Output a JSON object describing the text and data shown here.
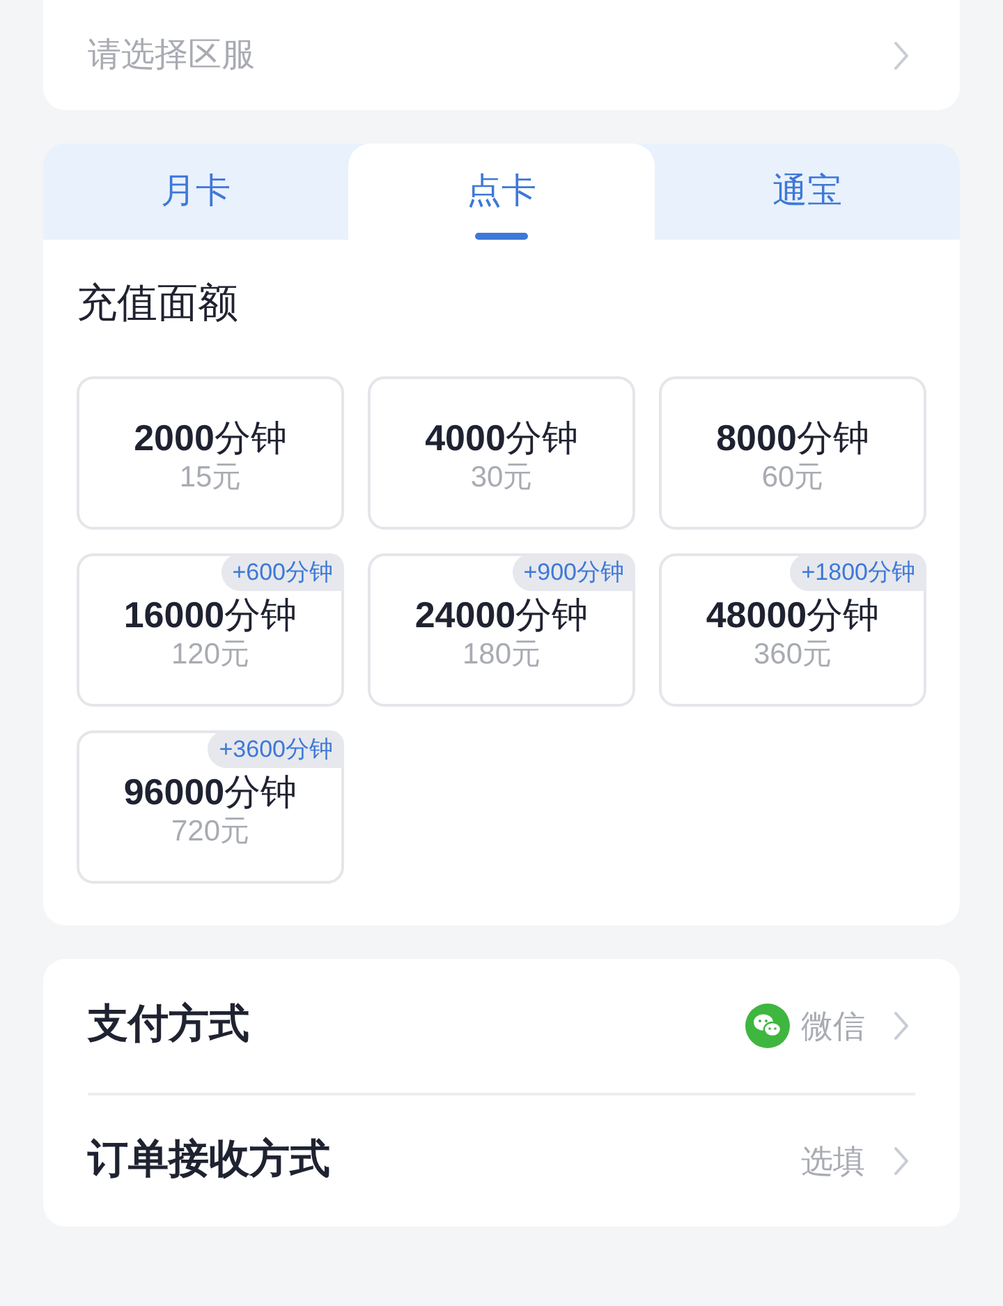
{
  "server_select": {
    "placeholder": "请选择区服"
  },
  "tabs": [
    {
      "label": "月卡",
      "selected": false
    },
    {
      "label": "点卡",
      "selected": true
    },
    {
      "label": "通宝",
      "selected": false
    }
  ],
  "section_title": "充值面额",
  "options": [
    {
      "amount": "**2000**分钟",
      "price": "15元"
    },
    {
      "amount": "**4000**分钟",
      "price": "30元"
    },
    {
      "amount": "**8000**分钟",
      "price": "60元"
    },
    {
      "amount": "**16000**分钟",
      "price": "120元",
      "bonus": "+600分钟"
    },
    {
      "amount": "**24000**分钟",
      "price": "180元",
      "bonus": "+900分钟"
    },
    {
      "amount": "**48000**分钟",
      "price": "360元",
      "bonus": "+1800分钟"
    },
    {
      "amount": "**96000**分钟",
      "price": "720元",
      "bonus": "+3600分钟"
    }
  ],
  "settings": [
    {
      "kind": "wechat",
      "label": "支付方式",
      "value": "微信"
    },
    {
      "kind": "plain",
      "label": "订单接收方式",
      "value": "选填"
    }
  ]
}
